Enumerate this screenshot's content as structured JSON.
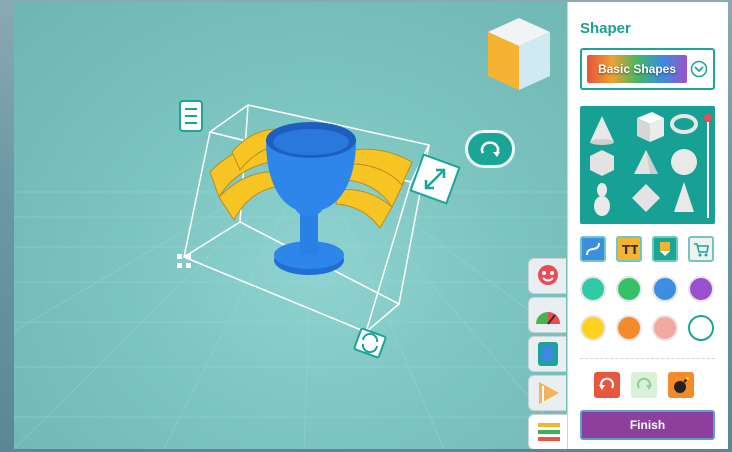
{
  "panel": {
    "title": "Shaper",
    "shape_category": "Basic Shapes",
    "shapes": [
      "cone",
      "cube",
      "torus",
      "dodecahedron",
      "tetrahedron",
      "sphere",
      "bowling-pin",
      "octahedron",
      "tall-cone"
    ],
    "colors": [
      "#2ecba6",
      "#34c269",
      "#3d8ee3",
      "#9a4fd0",
      "#ffd21f",
      "#f48a2a",
      "#f3a8a2",
      "#ffffff"
    ],
    "finish_label": "Finish"
  },
  "categories": [
    "face",
    "gauge",
    "phone",
    "cone-stripes",
    "tools"
  ],
  "accent": "#1aa597"
}
